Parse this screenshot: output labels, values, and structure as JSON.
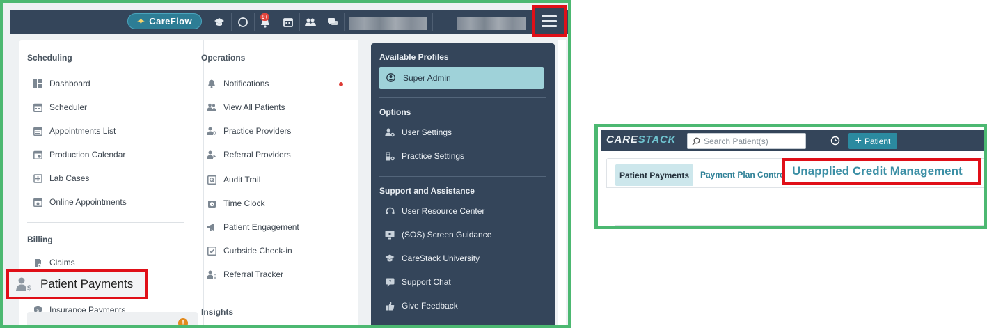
{
  "topbar": {
    "careflow_label": "CareFlow",
    "notification_count": "9+",
    "icons": [
      "graduation-cap-icon",
      "chat-bubble-icon",
      "bell-icon",
      "calendar-icon",
      "users-icon",
      "comments-icon"
    ]
  },
  "menu": {
    "scheduling": {
      "title": "Scheduling",
      "items": [
        {
          "label": "Dashboard",
          "icon": "dashboard-icon"
        },
        {
          "label": "Scheduler",
          "icon": "calendar-icon"
        },
        {
          "label": "Appointments List",
          "icon": "calendar-list-icon"
        },
        {
          "label": "Production Calendar",
          "icon": "calendar-gear-icon"
        },
        {
          "label": "Lab Cases",
          "icon": "lab-case-icon"
        },
        {
          "label": "Online Appointments",
          "icon": "calendar-online-icon"
        }
      ]
    },
    "billing": {
      "title": "Billing",
      "items": [
        {
          "label": "Claims",
          "icon": "claims-icon"
        },
        {
          "label": "Patient Payments",
          "icon": "patient-payment-icon"
        },
        {
          "label": "Insurance Payments",
          "icon": "insurance-shield-icon"
        }
      ]
    },
    "operations": {
      "title": "Operations",
      "items": [
        {
          "label": "Notifications",
          "icon": "bell-icon"
        },
        {
          "label": "View All Patients",
          "icon": "users-icon"
        },
        {
          "label": "Practice Providers",
          "icon": "provider-icon"
        },
        {
          "label": "Referral Providers",
          "icon": "referral-icon"
        },
        {
          "label": "Audit Trail",
          "icon": "audit-icon"
        },
        {
          "label": "Time Clock",
          "icon": "clock-icon"
        },
        {
          "label": "Patient Engagement",
          "icon": "megaphone-icon"
        },
        {
          "label": "Curbside Check-in",
          "icon": "checkin-icon"
        },
        {
          "label": "Referral Tracker",
          "icon": "tracker-icon"
        }
      ]
    },
    "insights": {
      "title": "Insights"
    }
  },
  "profiles": {
    "available_title": "Available Profiles",
    "selected_profile": "Super Admin",
    "options_title": "Options",
    "options": [
      {
        "label": "User Settings",
        "icon": "user-gear-icon"
      },
      {
        "label": "Practice Settings",
        "icon": "building-gear-icon"
      }
    ],
    "support_title": "Support and Assistance",
    "support": [
      {
        "label": "User Resource Center",
        "icon": "headset-icon"
      },
      {
        "label": "(SOS) Screen Guidance",
        "icon": "screen-play-icon"
      },
      {
        "label": "CareStack University",
        "icon": "graduation-cap-icon"
      },
      {
        "label": "Support Chat",
        "icon": "chat-icon"
      },
      {
        "label": "Give Feedback",
        "icon": "thumbs-up-icon"
      }
    ]
  },
  "carestack": {
    "logo_primary": "CARE",
    "logo_accent": "STACK",
    "search_placeholder": "Search Patient(s)",
    "add_patient_label": "Patient",
    "tabs": {
      "patient_payments": "Patient Payments",
      "payment_plan_control": "Payment Plan Control",
      "unapplied_credit": "Unapplied Credit Management"
    }
  },
  "colors": {
    "frame_green": "#4cb871",
    "highlight_red": "#e00f18",
    "navy": "#34455a",
    "teal_accent": "#2d7d95",
    "profile_selected": "#9fd2d9"
  }
}
